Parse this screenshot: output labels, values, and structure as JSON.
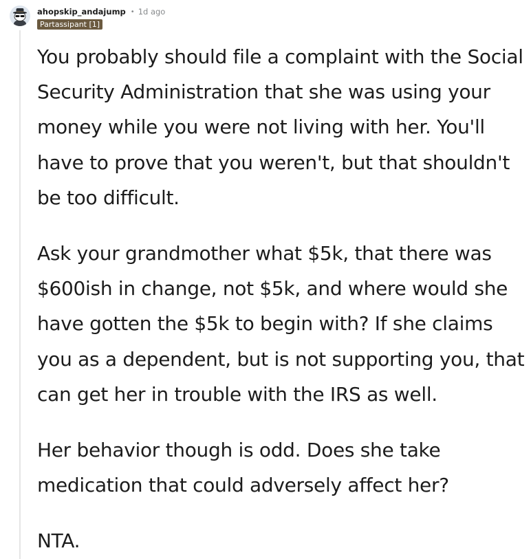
{
  "comment": {
    "username": "ahopskip_andajump",
    "separator": "•",
    "timestamp": "1d ago",
    "flair": "Partassipant [1]",
    "avatar": "snoo-avatar-with-hat-and-sunglasses",
    "paragraphs": [
      "You probably should file a complaint with the Social Security Administration that she was using your money while you were not living with her. You'll have to prove that you weren't, but that shouldn't be too difficult.",
      "Ask your grandmother what $5k, that there was $600ish in change, not $5k, and where would she have gotten the $5k to begin with? If she claims you as a dependent, but is not supporting you, that can get her in trouble with the IRS as well.",
      "Her behavior though is odd. Does she take medication that could adversely affect her?",
      "NTA."
    ]
  },
  "colors": {
    "flair_bg": "#6b5a40",
    "text": "#1c1c1c",
    "meta_gray": "#878a8c",
    "thread_line": "#e5e5e5"
  }
}
